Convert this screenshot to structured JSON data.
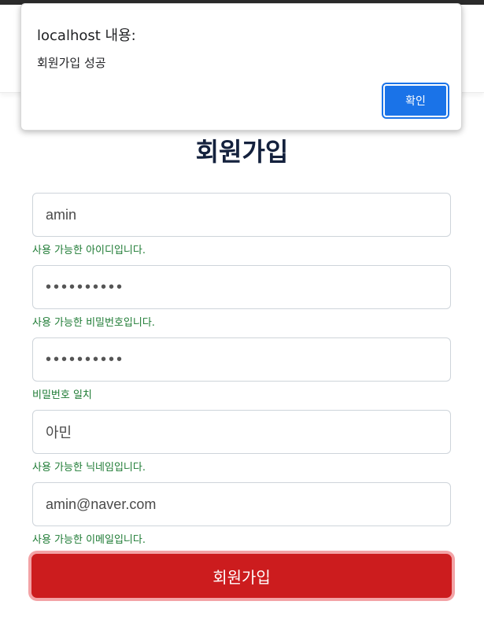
{
  "dialog": {
    "title": "localhost 내용:",
    "message": "회원가입 성공",
    "ok_label": "확인"
  },
  "page": {
    "title": "회원가입"
  },
  "form": {
    "id": {
      "value": "amin",
      "hint": "사용 가능한 아이디입니다."
    },
    "password": {
      "value": "••••••••••",
      "hint": "사용 가능한 비밀번호입니다."
    },
    "password_confirm": {
      "value": "••••••••••",
      "hint": "비밀번호 일치"
    },
    "nickname": {
      "value": "아민",
      "hint": "사용 가능한 닉네임입니다."
    },
    "email": {
      "value": "amin@naver.com",
      "hint": "사용 가능한 이메일입니다."
    },
    "submit_label": "회원가입"
  },
  "colors": {
    "dialog_button": "#1a73e8",
    "submit_button": "#cc1c1e",
    "hint_text": "#1e7b34",
    "title_text": "#14213d"
  }
}
